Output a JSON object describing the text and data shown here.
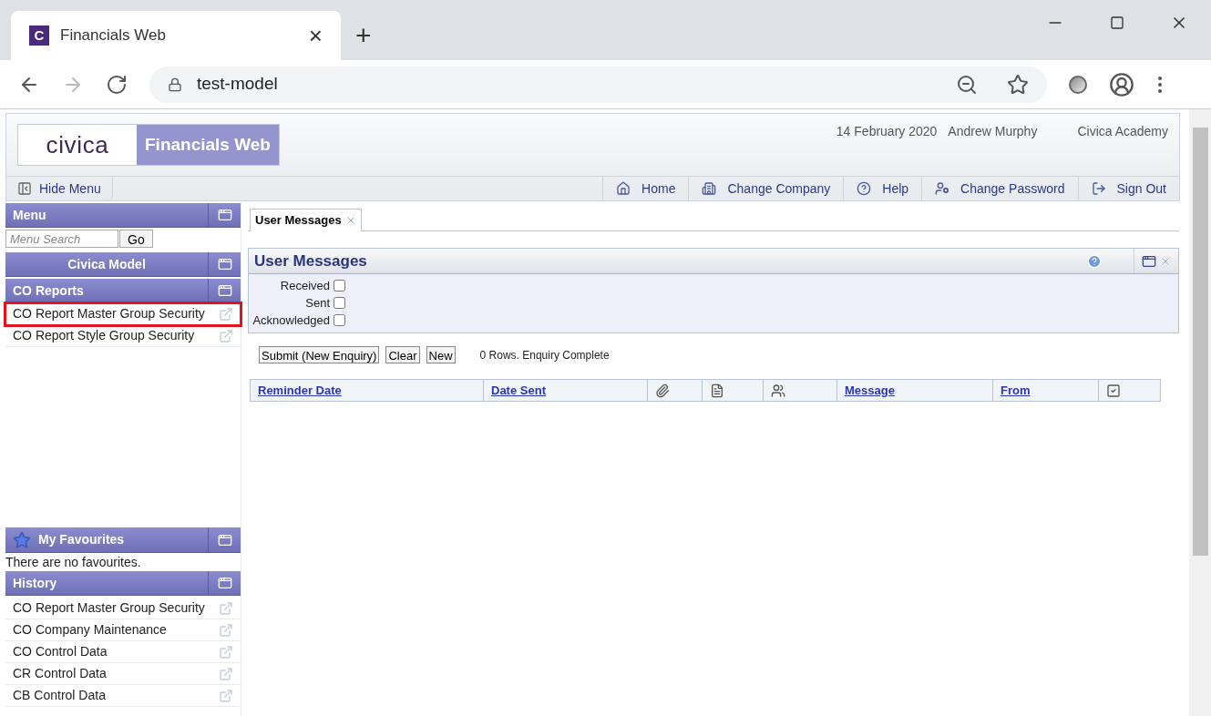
{
  "browser": {
    "tab": {
      "favicon": "C",
      "title": "Financials Web",
      "close": "×"
    },
    "new_tab": "+",
    "url": "test-model"
  },
  "header": {
    "logo": "civica",
    "product": "Financials Web",
    "date": "14 February 2020",
    "user": "Andrew Murphy",
    "organisation": "Civica Academy"
  },
  "hide_menu": "Hide Menu",
  "nav": [
    {
      "label": "Home",
      "kind": "home"
    },
    {
      "label": "Change Company",
      "kind": "company"
    },
    {
      "label": "Help",
      "kind": "help"
    },
    {
      "label": "Change Password",
      "kind": "password"
    },
    {
      "label": "Sign Out",
      "kind": "signout"
    }
  ],
  "sidebar": {
    "menu_title": "Menu",
    "search_placeholder": "Menu Search",
    "go": "Go",
    "company": "Civica Model",
    "section": "CO Reports",
    "items": [
      {
        "label": "CO Report Master Group Security",
        "highlighted": true
      },
      {
        "label": "CO Report Style Group Security",
        "highlighted": false
      }
    ],
    "favourites_title": "My Favourites",
    "favourites_empty": "There are no favourites.",
    "history_title": "History",
    "history": [
      "CO Report Master Group Security",
      "CO Company Maintenance",
      "CO Control Data",
      "CR Control Data",
      "CB Control Data"
    ]
  },
  "tabs": [
    {
      "label": "User Messages",
      "selected": true
    }
  ],
  "panel": {
    "title": "User Messages",
    "filters": [
      {
        "label": "Received",
        "checked": false
      },
      {
        "label": "Sent",
        "checked": false
      },
      {
        "label": "Acknowledged",
        "checked": false
      }
    ],
    "buttons": [
      "Submit (New Enquiry)",
      "Clear",
      "New"
    ],
    "status": "0 Rows. Enquiry Complete"
  },
  "table": {
    "columns": [
      {
        "kind": "text",
        "label": "Reminder Date"
      },
      {
        "kind": "text",
        "label": "Date Sent"
      },
      {
        "kind": "icon"
      },
      {
        "kind": "icon"
      },
      {
        "kind": "icon"
      },
      {
        "kind": "text",
        "label": "Message"
      },
      {
        "kind": "text",
        "label": "From"
      },
      {
        "kind": "icon"
      }
    ]
  }
}
